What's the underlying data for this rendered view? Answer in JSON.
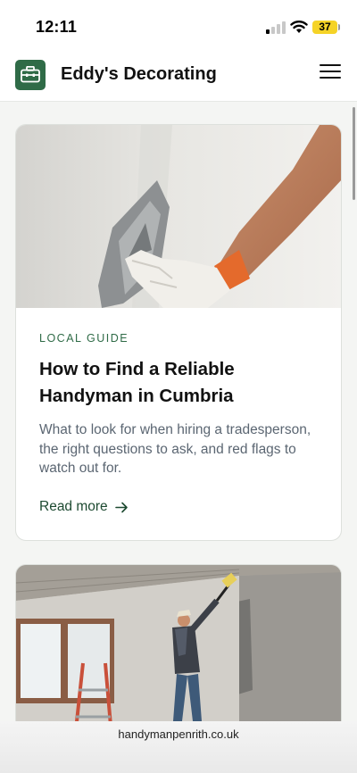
{
  "status_bar": {
    "time": "12:11",
    "battery_level": "37",
    "battery_color": "#f5d327"
  },
  "header": {
    "logo_icon": "toolbox-icon",
    "title": "Eddy's Decorating",
    "menu_icon": "hamburger-menu-icon"
  },
  "posts": [
    {
      "image": "hand-with-plastering-trowel-on-wall",
      "category": "LOCAL GUIDE",
      "title": "How to Find a Reliable Handyman in Cumbria",
      "excerpt": "What to look for when hiring a tradesperson, the right questions to ask, and red flags to watch out for.",
      "read_more": "Read more",
      "arrow_icon": "arrow-right-icon"
    },
    {
      "image": "painter-with-roller-on-ladder-room"
    }
  ],
  "browser": {
    "url": "handymanpenrith.co.uk"
  },
  "colors": {
    "brand_green": "#2f6b47",
    "link_green": "#1d4a31",
    "excerpt_gray": "#5b6672",
    "page_background": "#f4f5f3"
  }
}
